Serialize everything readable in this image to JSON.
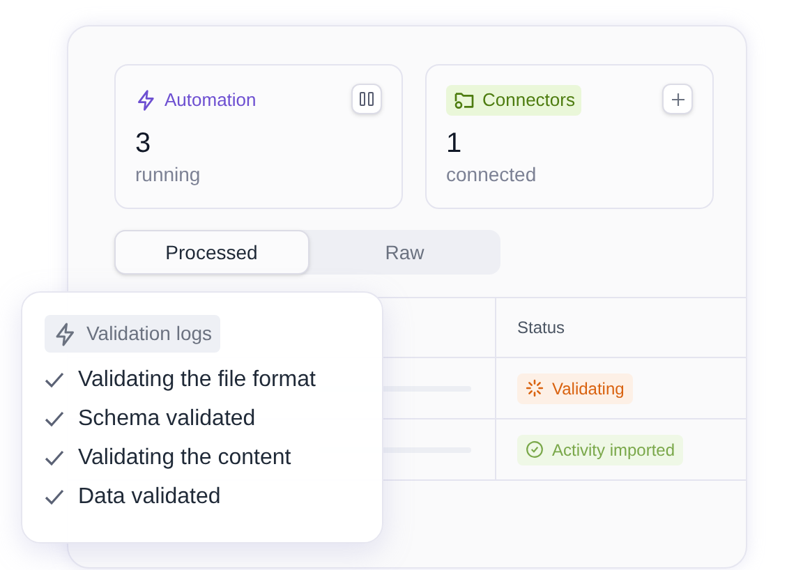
{
  "stats": [
    {
      "kind": "automation",
      "label": "Automation",
      "value": "3",
      "caption": "running"
    },
    {
      "kind": "connectors",
      "label": "Connectors",
      "value": "1",
      "caption": "connected"
    }
  ],
  "segments": [
    {
      "label": "Processed",
      "selected": true
    },
    {
      "label": "Raw",
      "selected": false
    }
  ],
  "table": {
    "columns": [
      "Status"
    ],
    "rows": [
      {
        "status": "Validating",
        "kind": "validating"
      },
      {
        "status": "Activity imported",
        "kind": "imported"
      }
    ]
  },
  "logs": {
    "title": "Validation logs",
    "items": [
      {
        "text": "Validating the file format",
        "checked": true
      },
      {
        "text": "Schema validated",
        "checked": true
      },
      {
        "text": "Validating the content",
        "checked": true
      },
      {
        "text": "Data validated",
        "checked": true
      }
    ]
  }
}
